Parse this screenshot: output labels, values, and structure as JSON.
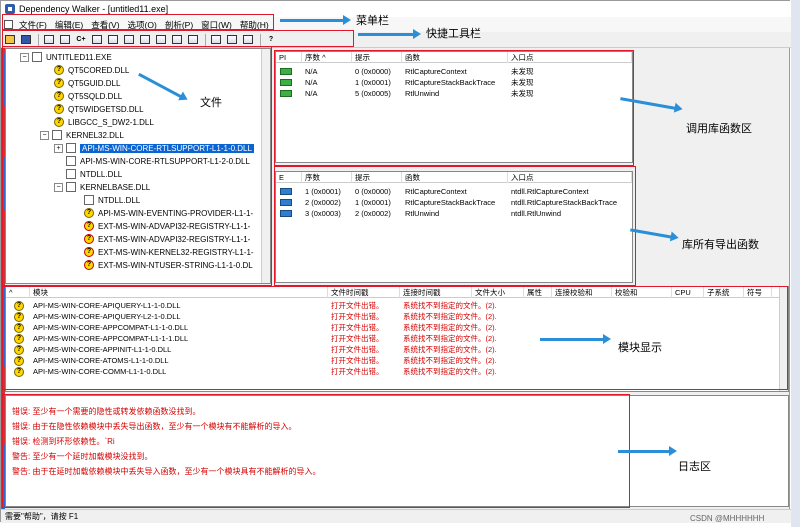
{
  "window": {
    "title": "Dependency Walker - [untitled11.exe]"
  },
  "menu": [
    {
      "label": "文件(F)"
    },
    {
      "label": "编辑(E)"
    },
    {
      "label": "查看(V)"
    },
    {
      "label": "选项(O)"
    },
    {
      "label": "剖析(P)"
    },
    {
      "label": "窗口(W)"
    },
    {
      "label": "帮助(H)"
    }
  ],
  "toolbar": {
    "buttons": [
      {
        "icon": "open-icon"
      },
      {
        "icon": "save-icon"
      },
      {
        "icon": "find-icon"
      },
      {
        "icon": "tree-icon"
      },
      {
        "icon": "c-plus-plus-icon",
        "text": "C+"
      },
      {
        "icon": "copy-icon"
      },
      {
        "icon": "view1-icon"
      },
      {
        "icon": "view2-icon"
      },
      {
        "icon": "view3-icon"
      },
      {
        "icon": "view4-icon"
      },
      {
        "icon": "view5-icon"
      },
      {
        "icon": "view6-icon"
      },
      {
        "icon": "layout1-icon"
      },
      {
        "icon": "layout2-icon"
      },
      {
        "icon": "layout3-icon"
      },
      {
        "icon": "help-icon",
        "text": "?"
      }
    ]
  },
  "tree": {
    "items": [
      {
        "label": "UNTITLED11.EXE",
        "icon": "box",
        "indent": 0,
        "expander": "−"
      },
      {
        "label": "QT5CORED.DLL",
        "icon": "q",
        "indent": 1
      },
      {
        "label": "QT5GUID.DLL",
        "icon": "q",
        "indent": 1
      },
      {
        "label": "QT5SQLD.DLL",
        "icon": "q",
        "indent": 1
      },
      {
        "label": "QT5WIDGETSD.DLL",
        "icon": "q",
        "indent": 1
      },
      {
        "label": "LIBGCC_S_DW2-1.DLL",
        "icon": "q",
        "indent": 1
      },
      {
        "label": "KERNEL32.DLL",
        "icon": "box",
        "indent": 1,
        "expander": "−"
      },
      {
        "label": "API-MS-WIN-CORE-RTLSUPPORT-L1-1-0.DLL",
        "icon": "box",
        "indent": 2,
        "expander": "+",
        "selected": true
      },
      {
        "label": "API-MS-WIN-CORE-RTLSUPPORT-L1-2-0.DLL",
        "icon": "box",
        "indent": 2
      },
      {
        "label": "NTDLL.DLL",
        "icon": "box",
        "indent": 2
      },
      {
        "label": "KERNELBASE.DLL",
        "icon": "box",
        "indent": 2,
        "expander": "−"
      },
      {
        "label": "NTDLL.DLL",
        "icon": "box",
        "indent": 3
      },
      {
        "label": "API-MS-WIN-EVENTING-PROVIDER-L1-1-",
        "icon": "q",
        "indent": 3
      },
      {
        "label": "EXT-MS-WIN-ADVAPI32-REGISTRY-L1-1-",
        "icon": "warn",
        "indent": 3
      },
      {
        "label": "EXT-MS-WIN-ADVAPI32-REGISTRY-L1-1-",
        "icon": "warn",
        "indent": 3
      },
      {
        "label": "EXT-MS-WIN-KERNEL32-REGISTRY-L1-1-",
        "icon": "warn",
        "indent": 3
      },
      {
        "label": "EXT-MS-WIN-NTUSER-STRING-L1-1-0.DL",
        "icon": "warn",
        "indent": 3
      }
    ]
  },
  "imports": {
    "headers": [
      "PI",
      "序数 ^",
      "提示",
      "函数",
      "入口点"
    ],
    "rows": [
      {
        "ordinal": "N/A",
        "hint": "0 (0x0000)",
        "function": "RtlCaptureContext",
        "entry": "未发现"
      },
      {
        "ordinal": "N/A",
        "hint": "1 (0x0001)",
        "function": "RtlCaptureStackBackTrace",
        "entry": "未发现"
      },
      {
        "ordinal": "N/A",
        "hint": "5 (0x0005)",
        "function": "RtlUnwind",
        "entry": "未发现"
      }
    ]
  },
  "exports": {
    "headers": [
      "E",
      "序数",
      "提示",
      "函数",
      "入口点"
    ],
    "rows": [
      {
        "ordinal": "1 (0x0001)",
        "hint": "0 (0x0000)",
        "function": "RtlCaptureContext",
        "entry": "ntdll.RtlCaptureContext"
      },
      {
        "ordinal": "2 (0x0002)",
        "hint": "1 (0x0001)",
        "function": "RtlCaptureStackBackTrace",
        "entry": "ntdll.RtlCaptureStackBackTrace"
      },
      {
        "ordinal": "3 (0x0003)",
        "hint": "2 (0x0002)",
        "function": "RtlUnwind",
        "entry": "ntdll.RtlUnwind"
      }
    ]
  },
  "modules": {
    "headers": [
      "^",
      "模块",
      "文件时间戳",
      "连接时间戳",
      "文件大小",
      "属性",
      "连接校验和",
      "校验和",
      "CPU",
      "子系统",
      "符号"
    ],
    "rows": [
      {
        "name": "API-MS-WIN-CORE-APIQUERY-L1-1-0.DLL",
        "err1": "打开文件出错。",
        "err2": "系统找不到指定的文件。(2)."
      },
      {
        "name": "API-MS-WIN-CORE-APIQUERY-L2-1-0.DLL",
        "err1": "打开文件出错。",
        "err2": "系统找不到指定的文件。(2)."
      },
      {
        "name": "API-MS-WIN-CORE-APPCOMPAT-L1-1-0.DLL",
        "err1": "打开文件出错。",
        "err2": "系统找不到指定的文件。(2)."
      },
      {
        "name": "API-MS-WIN-CORE-APPCOMPAT-L1-1-1.DLL",
        "err1": "打开文件出错。",
        "err2": "系统找不到指定的文件。(2)."
      },
      {
        "name": "API-MS-WIN-CORE-APPINIT-L1-1-0.DLL",
        "err1": "打开文件出错。",
        "err2": "系统找不到指定的文件。(2)."
      },
      {
        "name": "API-MS-WIN-CORE-ATOMS-L1-1-0.DLL",
        "err1": "打开文件出错。",
        "err2": "系统找不到指定的文件。(2)."
      },
      {
        "name": "API-MS-WIN-CORE-COMM-L1-1-0.DLL",
        "err1": "打开文件出错。",
        "err2": "系统找不到指定的文件。(2)."
      }
    ]
  },
  "log": {
    "lines": [
      "错误: 至少有一个需要的隐性或转发依赖函数没找到。",
      "错误: 由于在隐性依赖模块中丢失导出函数，至少有一个模块有不能解析的导入。",
      "错误: 检测到环形依赖性。`Ri",
      "警告: 至少有一个延时加载模块没找到。",
      "警告: 由于在延时加载依赖模块中丢失导入函数，至少有一个模块具有不能解析的导入。"
    ]
  },
  "status": {
    "text": "需要\"帮助\"，请按 F1"
  },
  "annotations": {
    "menubar": "菜单栏",
    "toolbar": "快捷工具栏",
    "files": "文件",
    "imports": "调用库函数区",
    "exports": "库所有导出函数",
    "modules": "模块显示",
    "log": "日志区"
  },
  "watermark": "CSDN @MHHHHHH",
  "colors": {
    "accent_box": "#e3162b",
    "arrow": "#2a8fd8",
    "error_text": "#d40000",
    "selection": "#0a64d2"
  }
}
